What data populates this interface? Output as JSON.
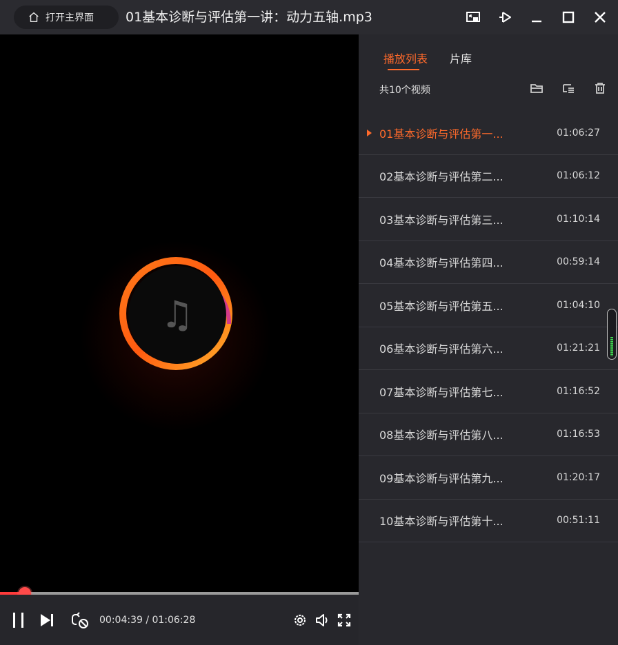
{
  "titlebar": {
    "home_label": "打开主界面",
    "title": "01基本诊断与评估第一讲：动力五轴.mp3",
    "controls": [
      "screen-icon",
      "pin-icon",
      "minimize-icon",
      "maximize-icon",
      "close-icon"
    ]
  },
  "player": {
    "current_time": "00:04:39",
    "total_time": "01:06:28",
    "time_display": "00:04:39 / 01:06:28",
    "progress": 0.07,
    "center_icon": "music-note-icon",
    "accent": "#ff4a4a"
  },
  "playlist": {
    "tabs": [
      "播放列表",
      "片库"
    ],
    "active_tab": 0,
    "count_label": "共10个视频",
    "accent": "#ff6a2b",
    "items": [
      {
        "name": "01基本诊断与评估第一...",
        "duration": "01:06:27"
      },
      {
        "name": "02基本诊断与评估第二...",
        "duration": "01:06:12"
      },
      {
        "name": "03基本诊断与评估第三...",
        "duration": "01:10:14"
      },
      {
        "name": "04基本诊断与评估第四...",
        "duration": "00:59:14"
      },
      {
        "name": "05基本诊断与评估第五...",
        "duration": "01:04:10"
      },
      {
        "name": "06基本诊断与评估第六...",
        "duration": "01:21:21"
      },
      {
        "name": "07基本诊断与评估第七...",
        "duration": "01:16:52"
      },
      {
        "name": "08基本诊断与评估第八...",
        "duration": "01:16:53"
      },
      {
        "name": "09基本诊断与评估第九...",
        "duration": "01:20:17"
      },
      {
        "name": "10基本诊断与评估第十...",
        "duration": "00:51:11"
      }
    ],
    "active_index": 0
  }
}
